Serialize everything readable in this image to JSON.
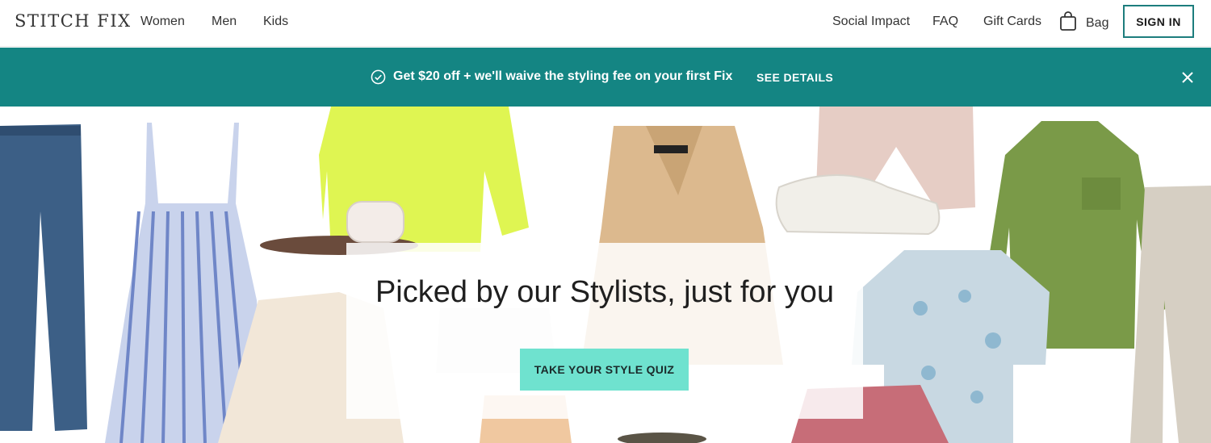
{
  "header": {
    "logo": "STITCH FIX",
    "nav_left": [
      "Women",
      "Men",
      "Kids"
    ],
    "nav_right": [
      "Social Impact",
      "FAQ",
      "Gift Cards"
    ],
    "bag_label": "Bag",
    "sign_in": "SIGN IN"
  },
  "promo": {
    "message": "Get $20 off + we'll waive the styling fee on your first Fix",
    "link": "SEE DETAILS"
  },
  "hero": {
    "title": "Picked by our Stylists, just for you",
    "cta": "TAKE YOUR STYLE QUIZ"
  },
  "colors": {
    "promo_bg": "#148583",
    "cta_bg": "#6fe2cf",
    "signin_border": "#1d7d7d"
  },
  "icons": [
    "bag-icon",
    "check-circle-icon",
    "close-icon"
  ]
}
